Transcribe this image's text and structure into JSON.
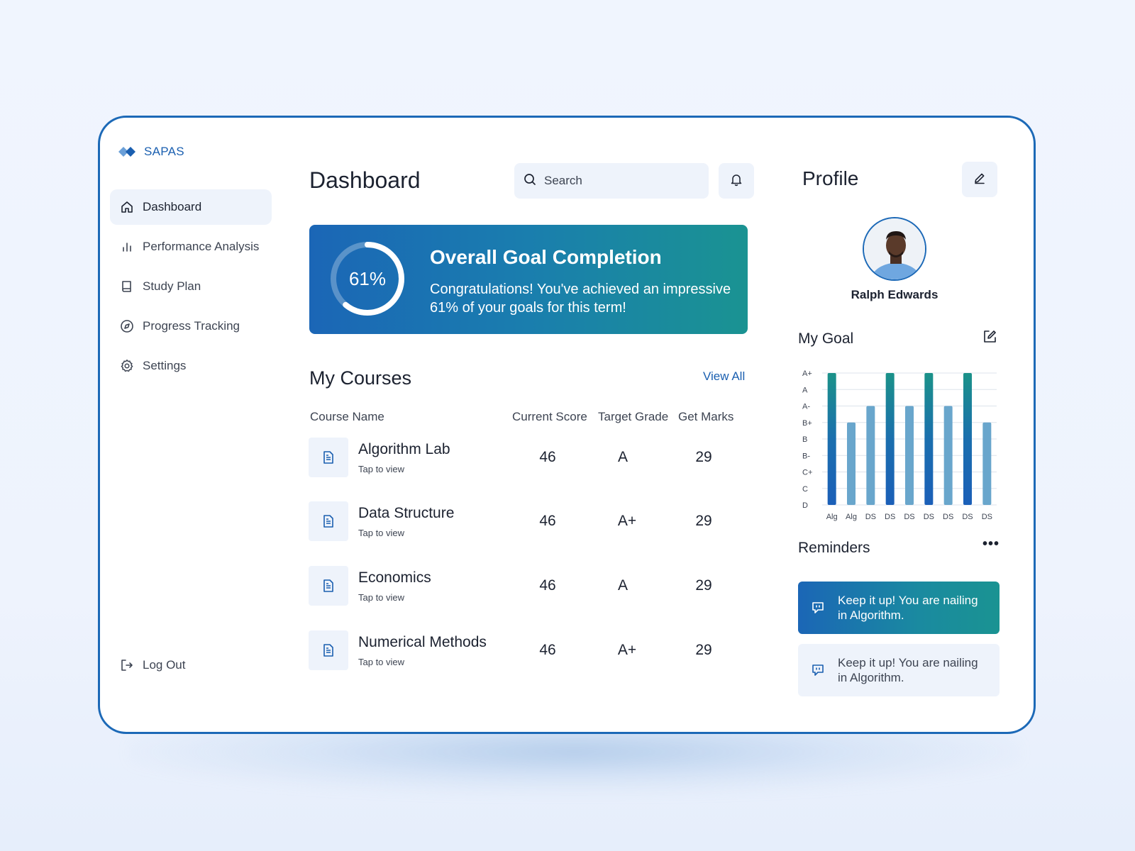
{
  "app": {
    "name": "SAPAS"
  },
  "sidebar": {
    "items": [
      {
        "label": "Dashboard",
        "icon": "home-icon",
        "active": true
      },
      {
        "label": "Performance Analysis",
        "icon": "bar-chart-icon"
      },
      {
        "label": "Study Plan",
        "icon": "book-icon"
      },
      {
        "label": "Progress Tracking",
        "icon": "compass-icon"
      },
      {
        "label": "Settings",
        "icon": "gear-icon"
      }
    ],
    "logout_label": "Log Out"
  },
  "header": {
    "title": "Dashboard",
    "search_placeholder": "Search"
  },
  "goal": {
    "percent": 61,
    "percent_label": "61%",
    "title": "Overall Goal Completion",
    "text": "Congratulations! You've achieved an impressive 61% of your goals for this term!"
  },
  "courses": {
    "title": "My Courses",
    "view_all": "View All",
    "headers": [
      "Course Name",
      "Current Score",
      "Target Grade",
      "Get Marks"
    ],
    "tap_label": "Tap to view",
    "rows": [
      {
        "name": "Algorithm Lab",
        "score": "46",
        "grade": "A",
        "marks": "29"
      },
      {
        "name": "Data Structure",
        "score": "46",
        "grade": "A+",
        "marks": "29"
      },
      {
        "name": "Economics",
        "score": "46",
        "grade": "A",
        "marks": "29"
      },
      {
        "name": "Numerical Methods",
        "score": "46",
        "grade": "A+",
        "marks": "29"
      }
    ]
  },
  "profile": {
    "title": "Profile",
    "name": "Ralph Edwards"
  },
  "my_goal": {
    "title": "My Goal"
  },
  "chart_data": {
    "type": "bar",
    "categories": [
      "Alg",
      "Alg",
      "DS",
      "DS",
      "DS",
      "DS",
      "DS",
      "DS",
      "DS"
    ],
    "y_ticks": [
      "A+",
      "A",
      "A-",
      "B+",
      "B",
      "B-",
      "C+",
      "C",
      "D"
    ],
    "values": [
      "A+",
      "B+",
      "A-",
      "A+",
      "A-",
      "A+",
      "A-",
      "A+",
      "B+"
    ],
    "colors": [
      "#1b9289",
      "#69a6cc",
      "#69a6cc",
      "#1b9289",
      "#69a6cc",
      "#1b9289",
      "#69a6cc",
      "#1b9289",
      "#69a6cc"
    ],
    "grid": true
  },
  "reminders": {
    "title": "Reminders",
    "more_label": "•••",
    "items": [
      {
        "text": "Keep it up! You are nailing in Algorithm."
      },
      {
        "text": "Keep it up! You are nailing in Algorithm."
      }
    ]
  },
  "colors": {
    "accent": "#1c69b7",
    "teal": "#1a9392",
    "soft_bg": "#eef3fb"
  }
}
